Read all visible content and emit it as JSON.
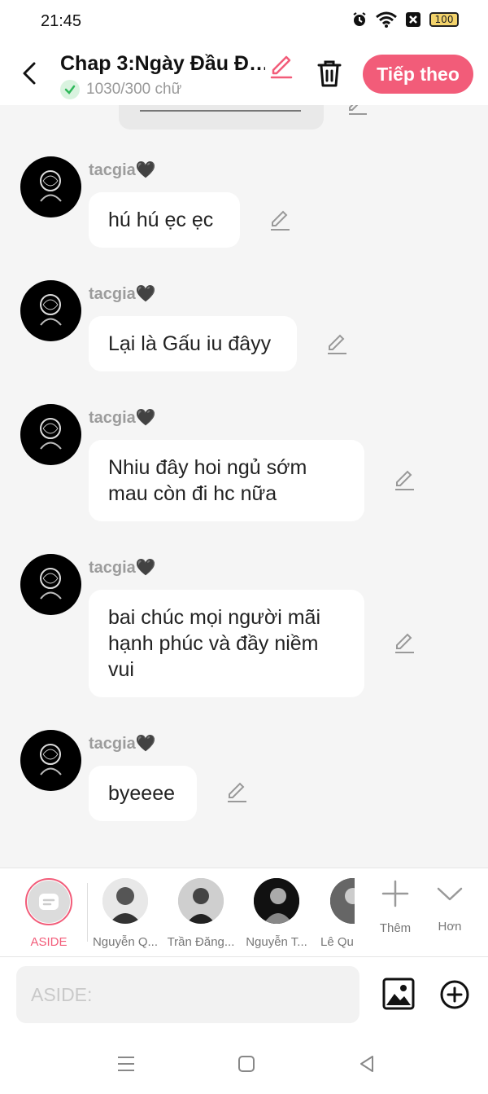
{
  "status_bar": {
    "time": "21:45",
    "battery": "100"
  },
  "header": {
    "title": "Chap 3:Ngày Đầu Đ…",
    "word_count": "1030/300 chữ",
    "next_label": "Tiếp theo"
  },
  "messages": [
    {
      "sender": "tacgia🖤",
      "text": "hú hú ẹc ẹc"
    },
    {
      "sender": "tacgia🖤",
      "text": "Lại là Gấu iu đâyy"
    },
    {
      "sender": "tacgia🖤",
      "text": "Nhiu đây hoi ngủ sớm mau còn đi hc nữa"
    },
    {
      "sender": "tacgia🖤",
      "text": "bai chúc mọi người mãi hạnh phúc và đầy niềm vui"
    },
    {
      "sender": "tacgia🖤",
      "text": "byeeee"
    }
  ],
  "characters": [
    {
      "label": "ASIDE"
    },
    {
      "label": "Nguyễn Q..."
    },
    {
      "label": "Trần Đăng..."
    },
    {
      "label": "Nguyễn T..."
    },
    {
      "label": "Lê Qu..."
    }
  ],
  "actions": {
    "more_label": "Thêm",
    "collapse_label": "Hơn"
  },
  "composer": {
    "placeholder": "ASIDE:"
  },
  "colors": {
    "accent": "#f25c79",
    "background": "#f5f5f5"
  }
}
